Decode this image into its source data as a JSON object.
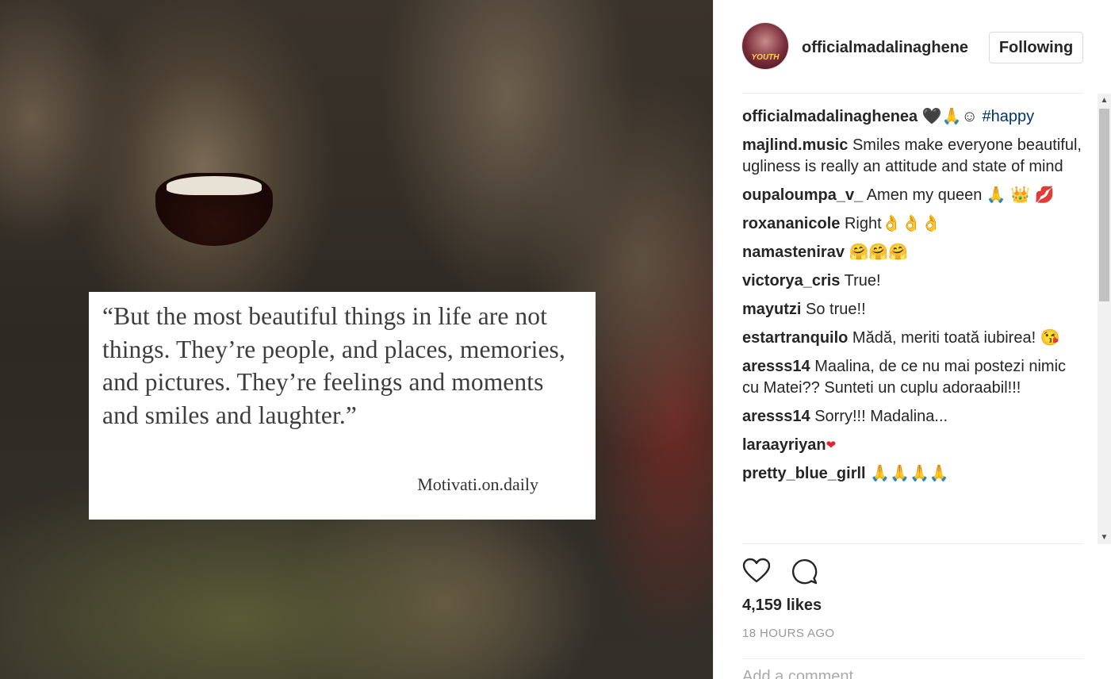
{
  "post_image": {
    "quote": "“But the most beautiful things in life are not things. They’re people, and places, memories, and pictures. They’re feelings and moments and smiles and laughter.”",
    "quote_source": "Motivati.on.daily"
  },
  "header": {
    "avatar_text": "YOUTH",
    "username": "officialmadalinaghenea",
    "follow_button": "Following"
  },
  "caption": {
    "user": "officialmadalinaghenea",
    "text": "🖤🙏☺",
    "hashtag": "#happy"
  },
  "comments": [
    {
      "user": "majlind.music",
      "text": "Smiles make everyone beautiful, ugliness is really an attitude and state of mind"
    },
    {
      "user": "oupaloumpa_v_",
      "text": "Amen my queen 🙏 👑 💋"
    },
    {
      "user": "roxananicole",
      "text": "Right👌👌👌"
    },
    {
      "user": "namastenirav",
      "text": "🤗🤗🤗"
    },
    {
      "user": "victorya_cris",
      "text": "True!"
    },
    {
      "user": "mayutzi",
      "text": "So true!!"
    },
    {
      "user": "estartranquilo",
      "text": "Mădă, meriti toată iubirea! 😘"
    },
    {
      "user": "aresss14",
      "text": "Maalina, de ce nu mai postezi nimic cu Matei?? Sunteti un cuplu adoraabil!!!"
    },
    {
      "user": "aresss14",
      "text": "Sorry!!! Madalina..."
    },
    {
      "user": "laraayriyan",
      "text": "❤"
    },
    {
      "user": "pretty_blue_girll",
      "text": "🙏🙏🙏🙏"
    }
  ],
  "actions": {
    "like_icon": "heart-icon",
    "comment_icon": "comment-icon"
  },
  "likes": "4,159 likes",
  "timestamp": "18 HOURS AGO",
  "add_comment_placeholder": "Add a comment..."
}
